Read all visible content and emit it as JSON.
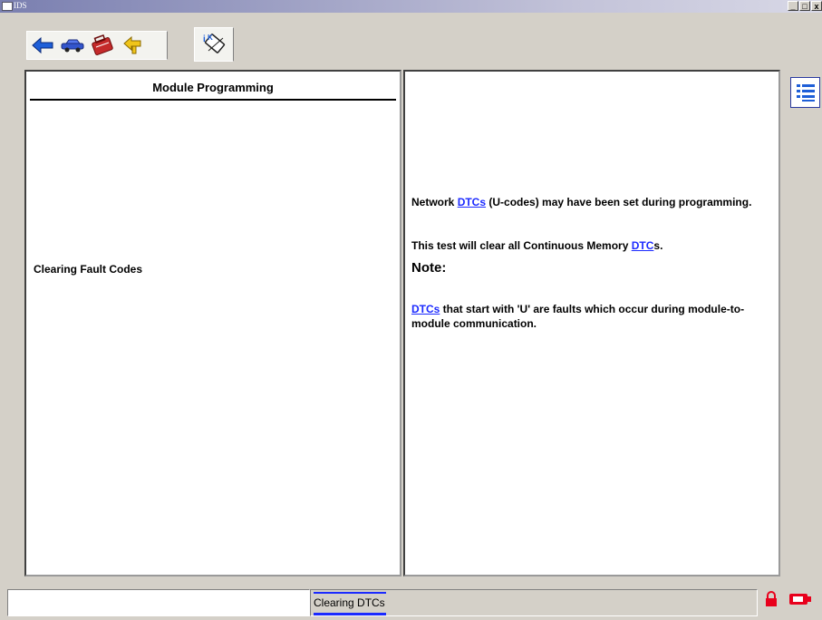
{
  "window": {
    "title": "IDS",
    "minimize": "_",
    "maximize": "□",
    "close": "x"
  },
  "toolbar": {
    "icons": [
      "back-arrow-icon",
      "vehicle-icon",
      "toolbox-icon",
      "forward-arrow-icon",
      "module-programming-icon"
    ]
  },
  "left_panel": {
    "heading": "Module Programming",
    "step": "Clearing Fault Codes"
  },
  "right_panel": {
    "p1_prefix": "Network ",
    "p1_link": "DTCs",
    "p1_suffix": " (U-codes) may have been set during programming.",
    "p2_prefix": "This test will clear all Continuous Memory ",
    "p2_link": "DTC",
    "p2_suffix": "s.",
    "note_heading": "Note:",
    "p3_link": "DTCs",
    "p3_suffix": " that start with 'U' are faults which occur during module-to-module communication."
  },
  "statusbar": {
    "status_text": "Clearing DTCs"
  },
  "colors": {
    "link": "#1b2aff",
    "lock": "#e8001c",
    "battery": "#e8001c"
  }
}
